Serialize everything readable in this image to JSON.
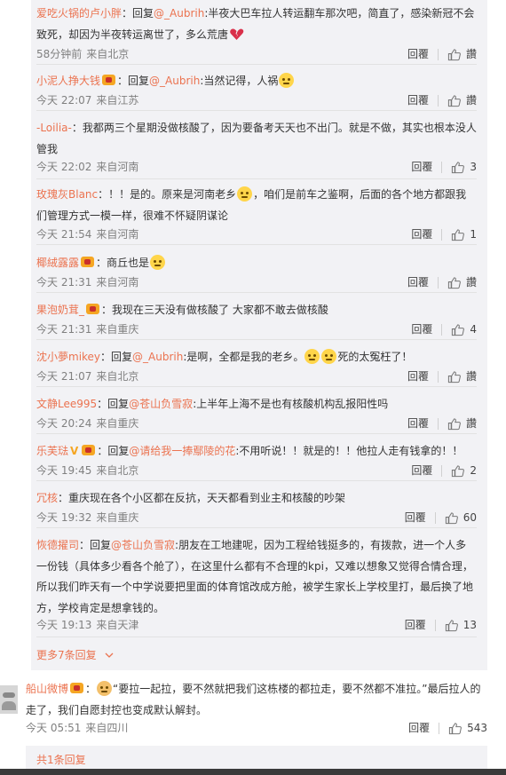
{
  "replies": [
    {
      "user": "爱吃火锅的卢小胖",
      "pre": "：回复",
      "at": "@_Aubrih",
      "text": ":半夜大巴车拉人转运翻车那次吧，简直了，感染新冠不会致死，却因为半夜转运离世了，多么荒唐",
      "emoji": "broken-heart-emoji",
      "time": "58分钟前",
      "loc": "来自北京",
      "likes": ""
    },
    {
      "user": "小泥人挣大钱",
      "badge": "vip-icon",
      "pre": "：回复",
      "at": "@_Aubrih",
      "text": ":当然记得，人祸",
      "emoji": "sad-face-emoji",
      "time": "今天 22:07",
      "loc": "来自江苏",
      "likes": ""
    },
    {
      "user": "-Loilia-",
      "pre": "：",
      "text": "我都两三个星期没做核酸了，因为要备考天天也不出门。就是不做，其实也根本没人管我",
      "time": "今天 22:02",
      "loc": "来自河南",
      "likes": "3"
    },
    {
      "user": "玫瑰灰Blanc",
      "pre": "：",
      "text": "！！是的。原来是河南老乡",
      "emoji": "crying-face-emoji",
      "text2": "，咱们是前车之鉴啊，后面的各个地方都跟我们管理方式一模一样，很难不怀疑阴谋论",
      "time": "今天 21:54",
      "loc": "来自河南",
      "likes": "1"
    },
    {
      "user": "椰絨露露",
      "badge": "vip-icon",
      "pre": "：",
      "text": "商丘也是",
      "emoji": "crying-face-emoji",
      "time": "今天 21:31",
      "loc": "来自河南",
      "likes": ""
    },
    {
      "user": "果泡奶茸_",
      "badge": "vip-icon",
      "pre": "：",
      "text": "我现在三天没有做核酸了 大家都不敢去做核酸",
      "time": "今天 21:31",
      "loc": "来自重庆",
      "likes": "4"
    },
    {
      "user": "沈小夢mikey",
      "pre": "：回复",
      "at": "@_Aubrih",
      "text": ":是啊，全都是我的老乡。",
      "emoji": "crying-face-emoji",
      "text2": "死的太冤枉了！",
      "time": "今天 21:07",
      "loc": "来自北京",
      "likes": ""
    },
    {
      "user": "文静Lee995",
      "pre": "：回复",
      "at": "@苍山负雪寂",
      "text": ":上半年上海不是也有核酸机构乱报阳性吗",
      "time": "今天 20:24",
      "loc": "来自重庆",
      "likes": ""
    },
    {
      "user": "乐芙琺",
      "badge": "vip-icon",
      "pre": "：回复",
      "at": "@请给我一捧鄢陵的花",
      "text": ":不用听说！！就是的！！他拉人走有钱拿的！！",
      "time": "今天 19:45",
      "loc": "来自北京",
      "likes": "2"
    },
    {
      "user": "冗核",
      "pre": "：",
      "text": "重庆现在各个小区都在反抗，天天都看到业主和核酸的吵架",
      "time": "今天 19:32",
      "loc": "来自重庆",
      "likes": "60"
    },
    {
      "user": "恢德擢司",
      "pre": "：回复",
      "at": "@苍山负雪寂",
      "text": ":朋友在工地建呢，因为工程给钱挺多的，有拨款，进一个人多一份钱（具体多少看各个舱了），在这里什么都有不合理的kpi，又难以想象又觉得合情合理，所以我们昨天有一个中学说要把里面的体育馆改成方舱，被学生家长上学校里打，最后换了地方，学校肯定是想拿钱的。",
      "time": "今天 19:13",
      "loc": "来自天津",
      "likes": "13"
    }
  ],
  "more_replies": "更多7条回复",
  "main": {
    "user": "船山微博",
    "badge": "vip-icon",
    "emoji": "clap-emoji",
    "text": "“要拉一起拉，要不然就把我们这栋楼的都拉走，要不然都不准拉。”最后拉人的走了，我们自愿封控也变成默认解封。",
    "time": "今天 05:51",
    "loc": "来自四川",
    "likes": "543"
  },
  "total_replies": "共1条回复",
  "reply_label": "回覆",
  "like_label": "讚",
  "colors": {
    "accent": "#eb7350",
    "meta": "#808080",
    "panel": "#f2f2f5"
  }
}
